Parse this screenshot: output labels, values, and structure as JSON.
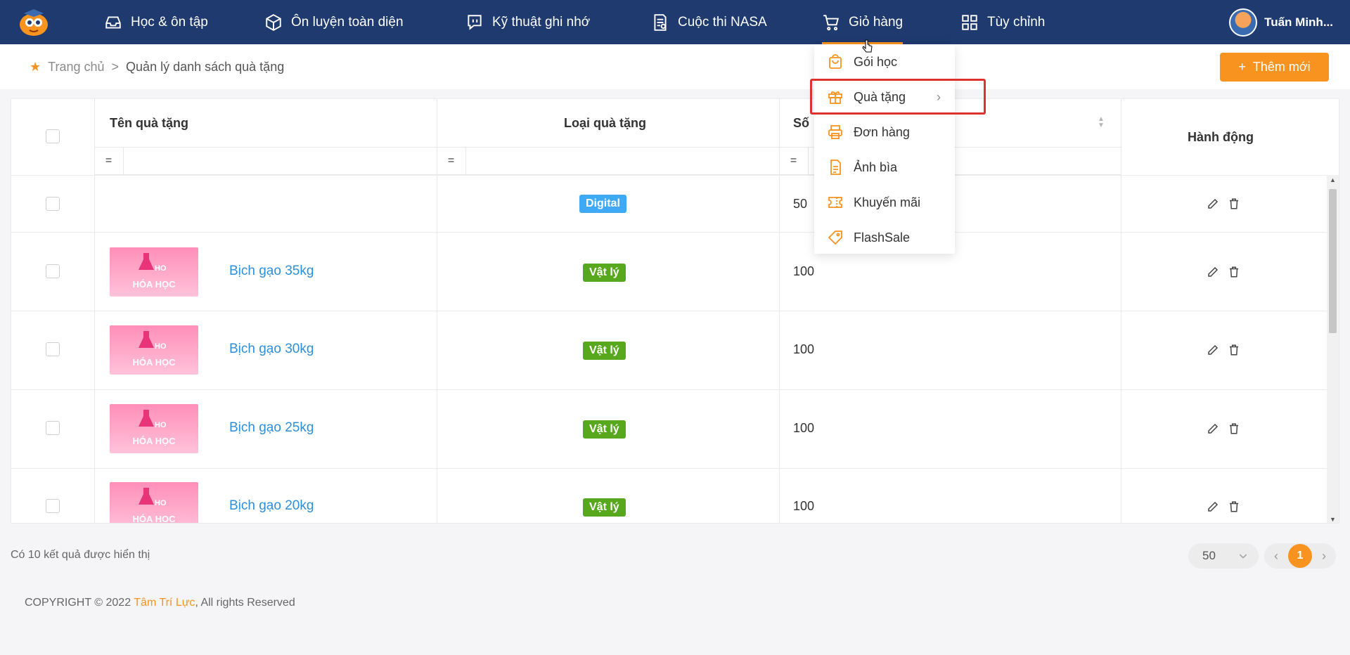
{
  "nav": {
    "items": [
      {
        "label": "Học & ôn tập",
        "icon": "inbox-icon"
      },
      {
        "label": "Ôn luyện toàn diện",
        "icon": "cube-icon"
      },
      {
        "label": "Kỹ thuật ghi nhớ",
        "icon": "chat-icon"
      },
      {
        "label": "Cuộc thi NASA",
        "icon": "document-icon"
      },
      {
        "label": "Giỏ hàng",
        "icon": "cart-icon"
      },
      {
        "label": "Tùy chỉnh",
        "icon": "grid-icon"
      }
    ],
    "user_name": "Tuấn Minh...",
    "accent_color": "#f7931e",
    "nav_color": "#1e3a6e"
  },
  "breadcrumb": {
    "home": "Trang chủ",
    "separator": ">",
    "current": "Quản lý danh sách quà tặng"
  },
  "add_button": {
    "label": "Thêm mới",
    "icon": "plus-icon"
  },
  "table": {
    "headers": {
      "name": "Tên quà tặng",
      "type": "Loại quà tặng",
      "quantity": "Số",
      "actions": "Hành động"
    },
    "filter_operator": "=",
    "rows": [
      {
        "name": "",
        "type": "Digital",
        "quantity": "50",
        "has_image": false
      },
      {
        "name": "Bịch gạo 35kg",
        "type": "Vật lý",
        "quantity": "100",
        "has_image": true,
        "image_text": "HÓA HỌC"
      },
      {
        "name": "Bịch gạo 30kg",
        "type": "Vật lý",
        "quantity": "100",
        "has_image": true,
        "image_text": "HÓA HỌC"
      },
      {
        "name": "Bịch gạo 25kg",
        "type": "Vật lý",
        "quantity": "100",
        "has_image": true,
        "image_text": "HÓA HỌC"
      },
      {
        "name": "Bịch gạo 20kg",
        "type": "Vật lý",
        "quantity": "100",
        "has_image": true,
        "image_text": "HÓA HỌC"
      }
    ]
  },
  "footer": {
    "result_text": "Có 10 kết quả được hiển thị",
    "page_size": "50",
    "current_page": "1",
    "copyright_prefix": "COPYRIGHT © 2022 ",
    "copyright_brand": "Tâm Trí Lực",
    "copyright_suffix": ", All rights Reserved"
  },
  "dropdown": {
    "items": [
      {
        "label": "Gói học",
        "icon": "bag-icon"
      },
      {
        "label": "Quà tặng",
        "icon": "gift-icon",
        "has_submenu": true
      },
      {
        "label": "Đơn hàng",
        "icon": "printer-icon"
      },
      {
        "label": "Ảnh bìa",
        "icon": "file-icon"
      },
      {
        "label": "Khuyến mãi",
        "icon": "ticket-icon"
      },
      {
        "label": "FlashSale",
        "icon": "tag-icon"
      }
    ],
    "submenu_chevron": "›"
  }
}
